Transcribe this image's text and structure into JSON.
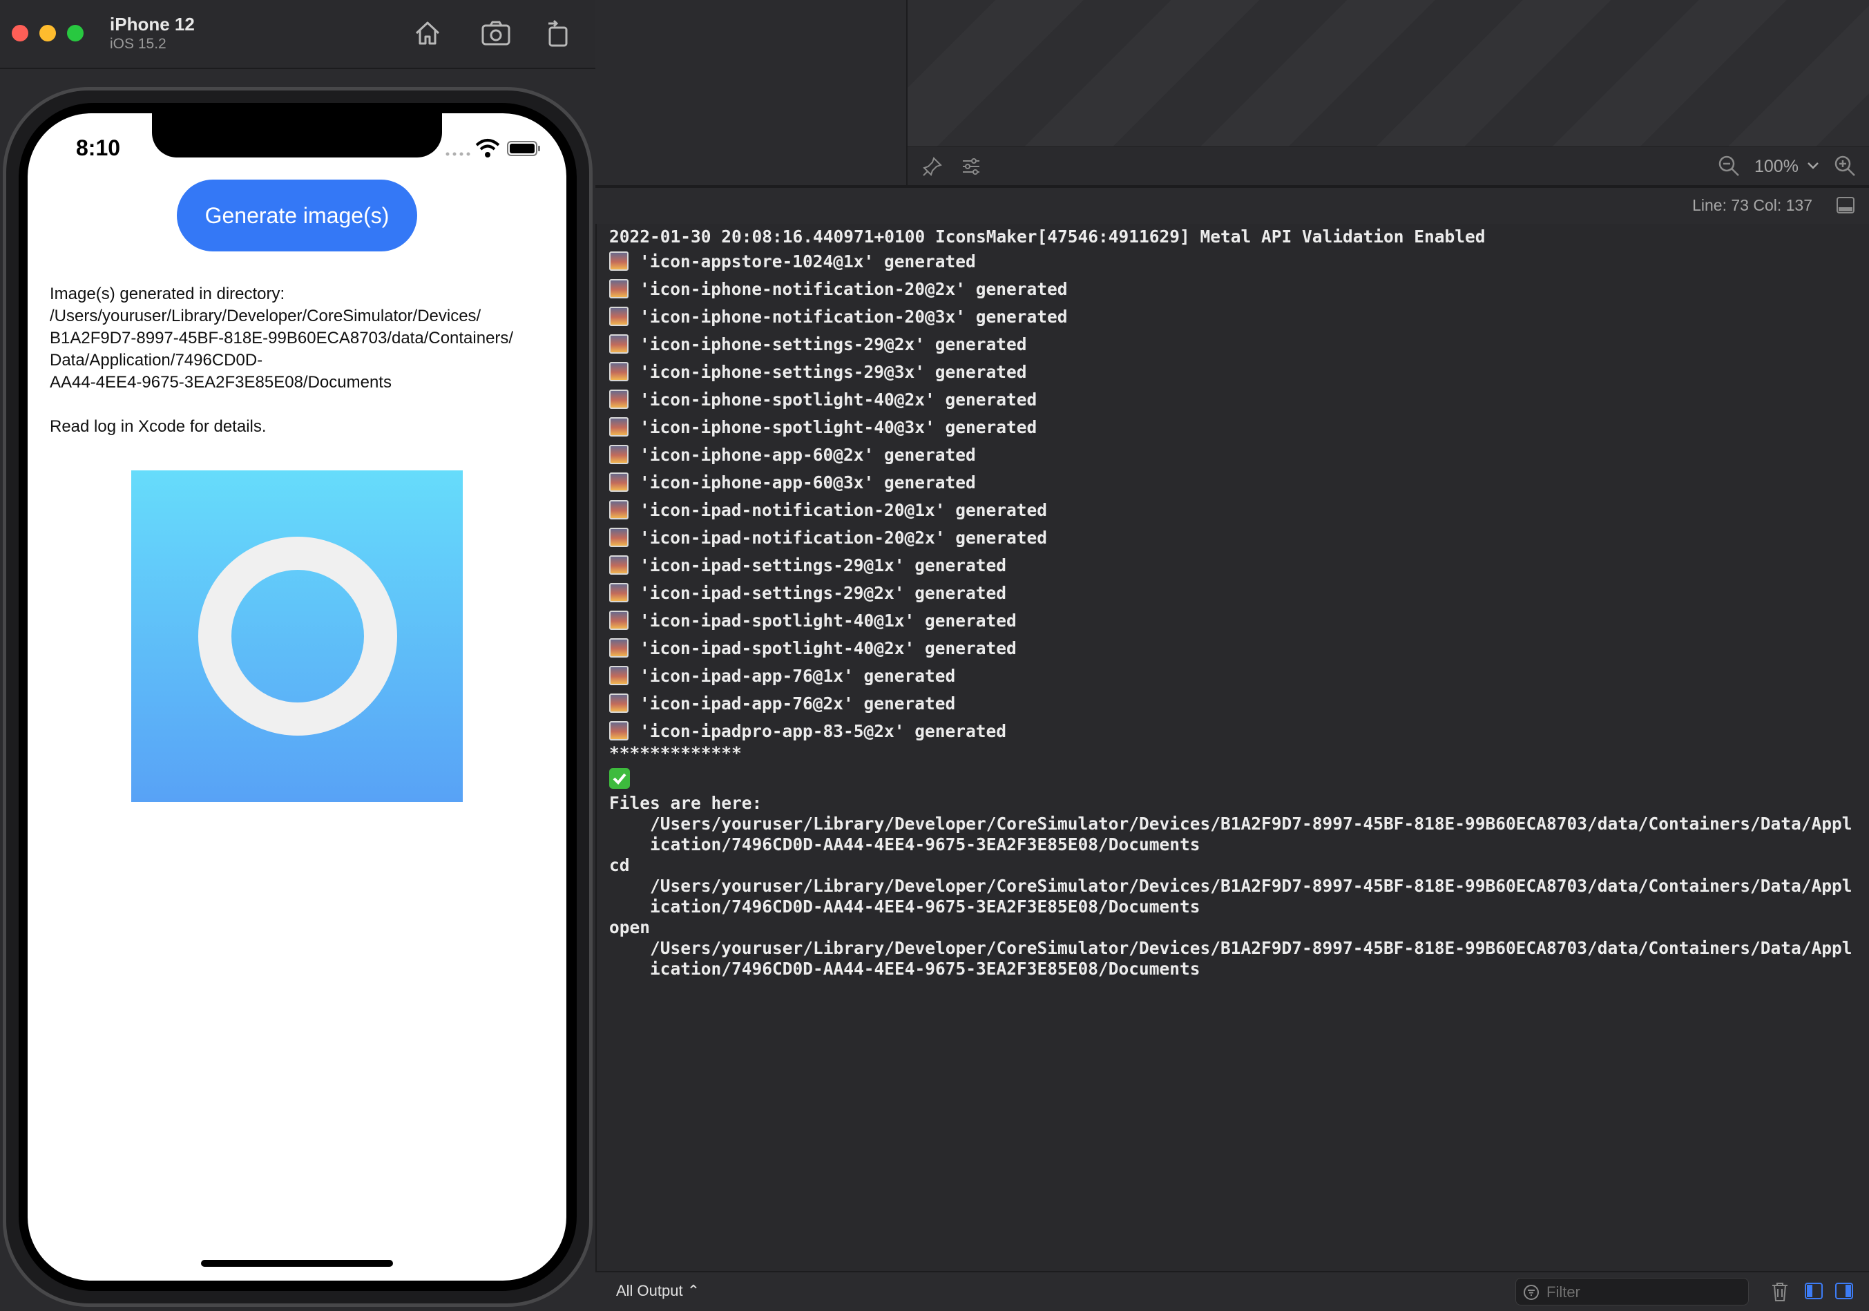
{
  "simulator": {
    "device_name": "iPhone 12",
    "os_version": "iOS 15.2",
    "status_time": "8:10",
    "app": {
      "generate_button_label": "Generate image(s)",
      "directory_text": "Image(s) generated in directory:\n/Users/youruser/Library/Developer/CoreSimulator/Devices/\nB1A2F9D7-8997-45BF-818E-99B60ECA8703/data/Containers/\nData/Application/7496CD0D-\nAA44-4EE4-9675-3EA2F3E85E08/Documents\n\nRead log in Xcode for details.",
      "icon_colors": {
        "gradient_top": "#66dcfb",
        "gradient_bottom": "#58a2f6",
        "ring": "#f0f0f0"
      }
    }
  },
  "canvas": {
    "zoom_level": "100%"
  },
  "editor": {
    "line_col": "Line: 73  Col: 137"
  },
  "console": {
    "header_line": "2022-01-30 20:08:16.440971+0100 IconsMaker[47546:4911629] Metal API Validation Enabled",
    "generated": [
      "'icon-appstore-1024@1x' generated",
      "'icon-iphone-notification-20@2x' generated",
      "'icon-iphone-notification-20@3x' generated",
      "'icon-iphone-settings-29@2x' generated",
      "'icon-iphone-settings-29@3x' generated",
      "'icon-iphone-spotlight-40@2x' generated",
      "'icon-iphone-spotlight-40@3x' generated",
      "'icon-iphone-app-60@2x' generated",
      "'icon-iphone-app-60@3x' generated",
      "'icon-ipad-notification-20@1x' generated",
      "'icon-ipad-notification-20@2x' generated",
      "'icon-ipad-settings-29@1x' generated",
      "'icon-ipad-settings-29@2x' generated",
      "'icon-ipad-spotlight-40@1x' generated",
      "'icon-ipad-spotlight-40@2x' generated",
      "'icon-ipad-app-76@1x' generated",
      "'icon-ipad-app-76@2x' generated",
      "'icon-ipadpro-app-83-5@2x' generated"
    ],
    "separator": "*************",
    "files_label": "Files are here:",
    "path_line1": "    /Users/youruser/Library/Developer/CoreSimulator/Devices/B1A2F9D7-8997-45BF-818E-99B60ECA8703/data/Containers/Data/Appl",
    "path_line2": "    ication/7496CD0D-AA44-4EE4-9675-3EA2F3E85E08/Documents",
    "cd_label": "cd",
    "open_label": "open"
  },
  "bottom_bar": {
    "output_select": "All Output ⌃",
    "filter_placeholder": "Filter"
  }
}
